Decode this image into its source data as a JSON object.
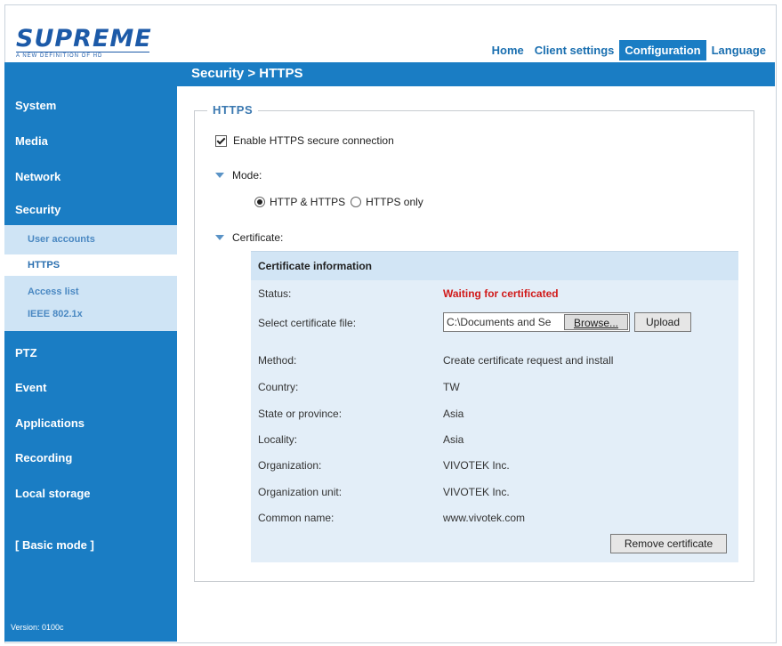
{
  "logo": {
    "word": "SUPREME",
    "tagline": "A NEW DEFINITION OF HD"
  },
  "topnav": {
    "tabs": [
      "Home",
      "Client settings",
      "Configuration",
      "Language"
    ]
  },
  "breadcrumb": "Security > HTTPS",
  "sidebar": {
    "items": [
      "System",
      "Media",
      "Network",
      "Security",
      "PTZ",
      "Event",
      "Applications",
      "Recording",
      "Local storage",
      "[ Basic mode ]"
    ],
    "security_sub": [
      "User accounts",
      "HTTPS",
      "Access list",
      "IEEE 802.1x"
    ],
    "version": "Version: 0100c"
  },
  "https": {
    "legend": "HTTPS",
    "enable_label": "Enable HTTPS secure connection",
    "mode_label": "Mode:",
    "mode_options": [
      "HTTP & HTTPS",
      "HTTPS only"
    ],
    "certificate_label": "Certificate:"
  },
  "certificate": {
    "title": "Certificate information",
    "status_label": "Status:",
    "status_value": "Waiting for certificated",
    "file_label": "Select certificate file:",
    "file_value": "C:\\Documents and Se",
    "browse_label": "Browse...",
    "upload_label": "Upload",
    "rows": [
      {
        "label": "Method:",
        "value": "Create certificate request and install"
      },
      {
        "label": "Country:",
        "value": "TW"
      },
      {
        "label": "State or province:",
        "value": "Asia"
      },
      {
        "label": "Locality:",
        "value": "Asia"
      },
      {
        "label": "Organization:",
        "value": "VIVOTEK Inc."
      },
      {
        "label": "Organization unit:",
        "value": "VIVOTEK Inc."
      },
      {
        "label": "Common name:",
        "value": "www.vivotek.com"
      }
    ],
    "remove_label": "Remove certificate"
  },
  "colors": {
    "accent": "#1a7dc4",
    "status": "#d11a1a",
    "panel": "#e3eef8"
  }
}
